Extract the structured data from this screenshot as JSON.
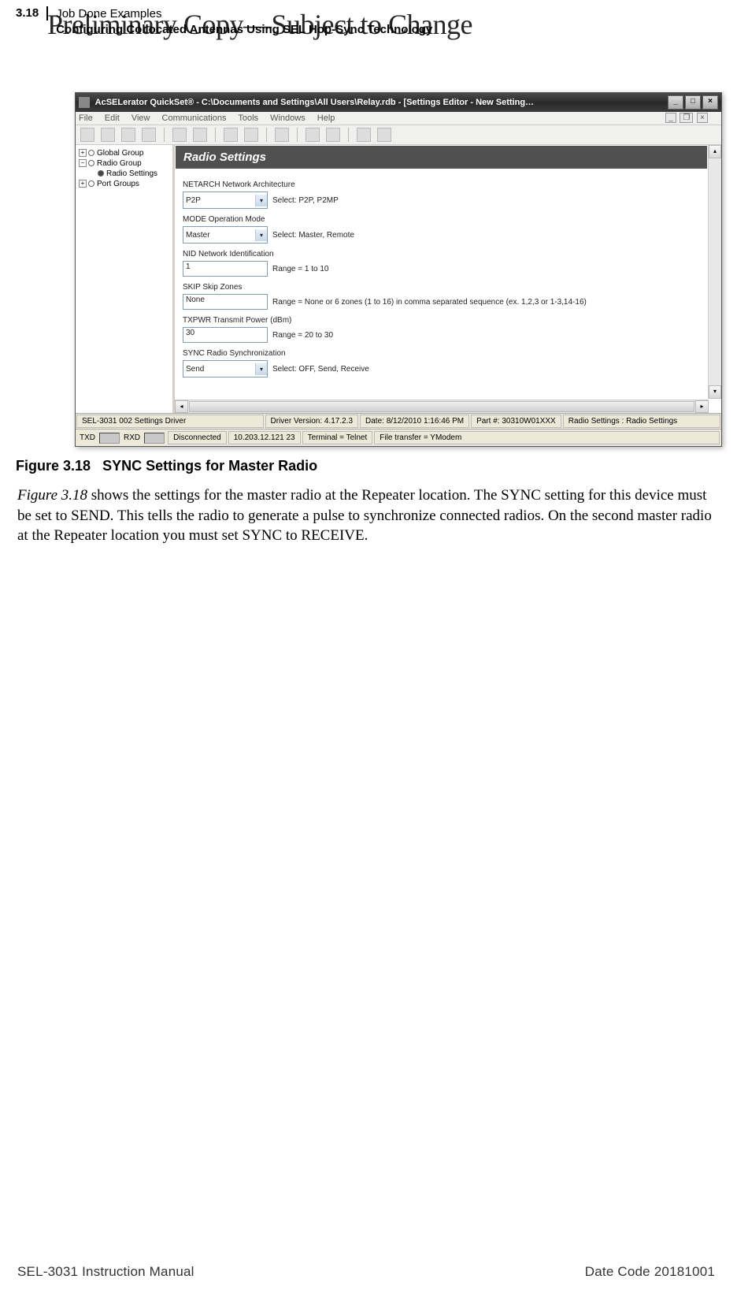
{
  "header": {
    "page_number": "3.18",
    "line1": "Job Done Examples",
    "line2": "Configuring Collocated Antennas Using SEL Hop-Sync Technology",
    "watermark": "Preliminary Copy—Subject to Change"
  },
  "window": {
    "title": "AcSELerator QuickSet® - C:\\Documents and Settings\\All Users\\Relay.rdb - [Settings Editor - New Setting…",
    "menu": [
      "File",
      "Edit",
      "View",
      "Communications",
      "Tools",
      "Windows",
      "Help"
    ],
    "tree": {
      "items": [
        {
          "label": "Global Group",
          "expand": "+",
          "filled": false,
          "indent": 0
        },
        {
          "label": "Radio Group",
          "expand": "−",
          "filled": false,
          "indent": 0
        },
        {
          "label": "Radio Settings",
          "expand": "",
          "filled": true,
          "indent": 2
        },
        {
          "label": "Port Groups",
          "expand": "+",
          "filled": false,
          "indent": 0
        }
      ]
    },
    "pane_title": "Radio Settings",
    "fields": {
      "netarch": {
        "label": "NETARCH  Network Architecture",
        "value": "P2P",
        "hint": "Select: P2P, P2MP"
      },
      "mode": {
        "label": "MODE  Operation Mode",
        "value": "Master",
        "hint": "Select: Master, Remote"
      },
      "nid": {
        "label": "NID  Network Identification",
        "value": "1",
        "hint": "Range = 1 to 10"
      },
      "skip": {
        "label": "SKIP  Skip Zones",
        "value": "None",
        "hint": "Range = None or 6 zones (1 to 16) in comma separated sequence (ex. 1,2,3 or 1-3,14-16)"
      },
      "txpwr": {
        "label": "TXPWR  Transmit Power (dBm)",
        "value": "30",
        "hint": "Range = 20 to 30"
      },
      "sync": {
        "label": "SYNC  Radio Synchronization",
        "value": "Send",
        "hint": "Select: OFF, Send, Receive"
      }
    },
    "status1": {
      "driver": "SEL-3031 002 Settings Driver",
      "version": "Driver Version: 4.17.2.3",
      "date": "Date: 8/12/2010 1:16:46 PM",
      "part": "Part #: 30310W01XXX",
      "context": "Radio Settings : Radio Settings"
    },
    "status2": {
      "txd": "TXD",
      "rxd": "RXD",
      "conn": "Disconnected",
      "addr": "10.203.12.121  23",
      "term": "Terminal = Telnet",
      "xfer": "File transfer = YModem"
    }
  },
  "figure": {
    "label": "Figure 3.18",
    "title": "SYNC Settings for Master Radio"
  },
  "body": {
    "ref": "Figure 3.18",
    "text_rest": " shows the settings for the master radio at the Repeater location. The SYNC setting for this device must be set to SEND. This tells the radio to generate a pulse to synchronize connected radios. On the second master radio at the Repeater location you must set SYNC to RECEIVE."
  },
  "footer": {
    "left": "SEL-3031 Instruction Manual",
    "right": "Date Code 20181001"
  }
}
